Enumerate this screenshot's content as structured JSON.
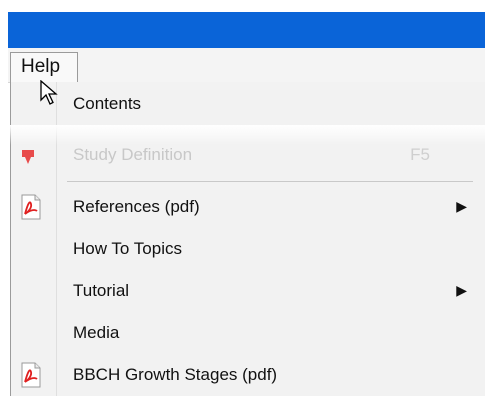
{
  "menubar": {
    "help_label": "Help"
  },
  "dropdown": {
    "items": {
      "contents": "Contents",
      "study_definition": "Study Definition",
      "study_definition_shortcut": "F5",
      "references": "References (pdf)",
      "how_to_topics": "How To Topics",
      "tutorial": "Tutorial",
      "media": "Media",
      "bbch": "BBCH Growth Stages (pdf)"
    },
    "submenu_arrow": "▶"
  },
  "colors": {
    "title_bar": "#0a64d8",
    "menu_bg": "#f2f2f2",
    "pdf_red": "#e02020"
  }
}
